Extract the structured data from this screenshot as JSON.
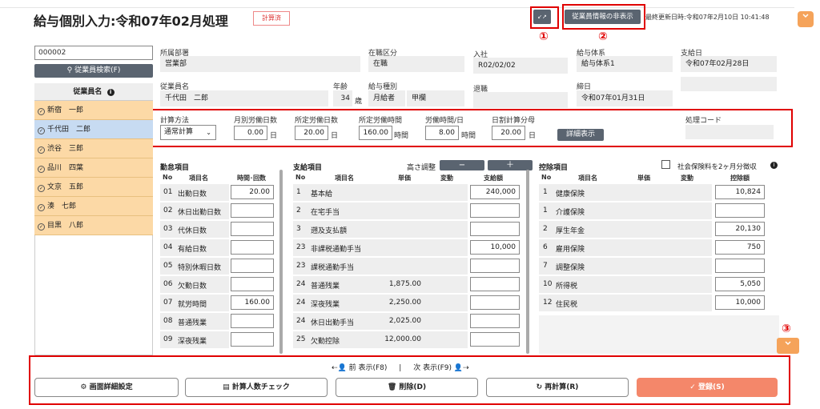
{
  "header": {
    "title": "給与個別入力:令和07年02月処理",
    "status": "計算済",
    "collapse_icon": "↙↗",
    "hide_emp_info": "従業員情報の非表示",
    "last_updated": "最終更新日時:令和07年2月10日 10:41:48",
    "scroll_top_icon": "chevron-down"
  },
  "markers": {
    "one": "①",
    "two": "②",
    "three": "③"
  },
  "left": {
    "emp_code": "000002",
    "search_btn": "従業員検索(F)",
    "list_header": "従業員名",
    "employees": [
      "新宿　一郎",
      "千代田　二郎",
      "渋谷　三郎",
      "品川　四葉",
      "文京　五郎",
      "湊　七郎",
      "目黒　八郎"
    ],
    "selected_index": 1
  },
  "info": {
    "dept_label": "所属部署",
    "dept": "営業部",
    "status_label": "在職区分",
    "status": "在職",
    "join_label": "入社",
    "join": "R02/02/02",
    "paysys_label": "給与体系",
    "paysys": "給与体系1",
    "paydate_label": "支給日",
    "paydate": "令和07年02月28日",
    "name_label": "従業員名",
    "name": "千代田　二郎",
    "age_label": "年齢",
    "age": "34",
    "age_unit": "歳",
    "paytype_label": "給与種別",
    "paytype1": "月給者",
    "paytype2": "甲欄",
    "retire_label": "退職",
    "retire": "",
    "close_label": "締日",
    "close": "令和07年01月31日"
  },
  "calc": {
    "method_label": "計算方法",
    "method": "通常計算",
    "monthly_days_label": "月別労働日数",
    "monthly_days": "0.00",
    "day_unit": "日",
    "fixed_days_label": "所定労働日数",
    "fixed_days": "20.00",
    "fixed_hours_label": "所定労働時間",
    "fixed_hours": "160.00",
    "hour_unit": "時間",
    "daily_hours_label": "労働時間/日",
    "daily_hours": "8.00",
    "hour_unit2": "時間",
    "daily_div_label": "日割計算分母",
    "daily_div": "20.00",
    "detail_btn": "詳細表示",
    "proc_code_label": "処理コード",
    "proc_code": ""
  },
  "attendance": {
    "title": "勤怠項目",
    "h_no": "No",
    "h_name": "項目名",
    "h_val": "時間･回数",
    "rows": [
      {
        "no": "01",
        "name": "出勤日数",
        "val": "20.00"
      },
      {
        "no": "02",
        "name": "休日出勤日数",
        "val": ""
      },
      {
        "no": "03",
        "name": "代休日数",
        "val": ""
      },
      {
        "no": "04",
        "name": "有給日数",
        "val": ""
      },
      {
        "no": "05",
        "name": "特別休暇日数",
        "val": ""
      },
      {
        "no": "06",
        "name": "欠勤日数",
        "val": ""
      },
      {
        "no": "07",
        "name": "就労時間",
        "val": "160.00"
      },
      {
        "no": "08",
        "name": "普通残業",
        "val": ""
      },
      {
        "no": "09",
        "name": "深夜残業",
        "val": ""
      }
    ]
  },
  "payment": {
    "title": "支給項目",
    "height_adj": "高さ調整",
    "minus": "−",
    "plus": "＋",
    "h_no": "No",
    "h_name": "項目名",
    "h_unit": "単価",
    "h_var": "変動",
    "h_amt": "支給額",
    "rows": [
      {
        "no": "1",
        "name": "基本給",
        "unit": "",
        "amt": "240,000"
      },
      {
        "no": "2",
        "name": "在宅手当",
        "unit": "",
        "amt": ""
      },
      {
        "no": "3",
        "name": "遡及支払額",
        "unit": "",
        "amt": ""
      },
      {
        "no": "23",
        "name": "非課税通勤手当",
        "unit": "",
        "amt": "10,000"
      },
      {
        "no": "23",
        "name": "課税通勤手当",
        "unit": "",
        "amt": ""
      },
      {
        "no": "24",
        "name": "普通残業",
        "unit": "1,875.00",
        "amt": ""
      },
      {
        "no": "24",
        "name": "深夜残業",
        "unit": "2,250.00",
        "amt": ""
      },
      {
        "no": "24",
        "name": "休日出勤手当",
        "unit": "2,025.00",
        "amt": ""
      },
      {
        "no": "25",
        "name": "欠勤控除",
        "unit": "12,000.00",
        "amt": ""
      }
    ]
  },
  "deduction": {
    "title": "控除項目",
    "social_label": "社会保険料を2ヶ月分徴収",
    "h_no": "No",
    "h_name": "項目名",
    "h_unit": "単価",
    "h_var": "変動",
    "h_amt": "控除額",
    "rows": [
      {
        "no": "1",
        "name": "健康保険",
        "amt": "10,824"
      },
      {
        "no": "1",
        "name": "介護保険",
        "amt": ""
      },
      {
        "no": "2",
        "name": "厚生年金",
        "amt": "20,130"
      },
      {
        "no": "6",
        "name": "雇用保険",
        "amt": "750"
      },
      {
        "no": "7",
        "name": "調整保険",
        "amt": ""
      },
      {
        "no": "10",
        "name": "所得税",
        "amt": "5,050"
      },
      {
        "no": "12",
        "name": "住民税",
        "amt": "10,000"
      }
    ]
  },
  "footer": {
    "prev": "前 表示(F8)",
    "sep": "|",
    "next": "次 表示(F9)",
    "settings": "画面詳細設定",
    "count_check": "計算人数チェック",
    "delete": "削除(D)",
    "recalc": "再計算(R)",
    "register": "登録(S)"
  }
}
